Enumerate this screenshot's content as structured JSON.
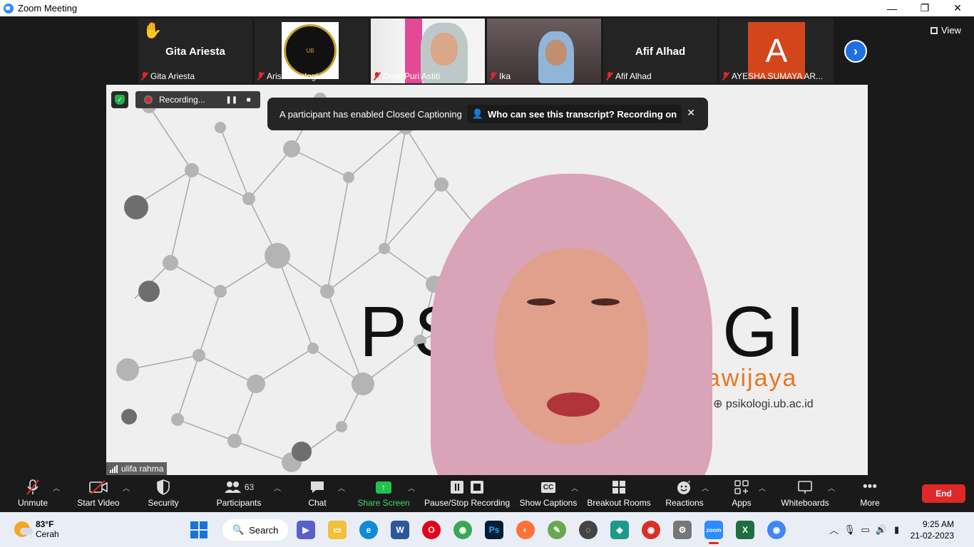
{
  "window": {
    "title": "Zoom Meeting",
    "minimize": "—",
    "maximize": "❐",
    "close": "✕"
  },
  "strip": {
    "thumbs": [
      {
        "center_name": "Gita Ariesta",
        "label": "Gita Ariesta"
      },
      {
        "label": "Aris Psikologi"
      },
      {
        "label": "Dewi Puri Astiti"
      },
      {
        "label": "Ika"
      },
      {
        "center_name": "Afif Alhad",
        "label": "Afif Alhad"
      },
      {
        "avatar_letter": "A",
        "label": "AYESHA SUMAYA AR..."
      }
    ],
    "next_icon": "›",
    "view_label": "View"
  },
  "main": {
    "recording_label": "Recording...",
    "cc_banner_text": "A participant has enabled Closed Captioning",
    "cc_banner_link": "Who can see this transcript? Recording on",
    "cc_close": "✕",
    "speaker_name": "ulifa rahma",
    "background_text": "PSIKOLOGI",
    "background_sub": "sBrawijaya",
    "background_web": "ologiub ⊕ psikologi.ub.ac.id"
  },
  "toolbar": {
    "unmute": "Unmute",
    "start_video": "Start Video",
    "security": "Security",
    "participants": "Participants",
    "participants_count": "63",
    "chat": "Chat",
    "share_screen": "Share Screen",
    "pause_stop_recording": "Pause/Stop Recording",
    "show_captions": "Show Captions",
    "breakout_rooms": "Breakout Rooms",
    "reactions": "Reactions",
    "apps": "Apps",
    "whiteboards": "Whiteboards",
    "more": "More",
    "end": "End",
    "cc_glyph": "CC"
  },
  "taskbar": {
    "temp": "83°F",
    "weather_desc": "Cerah",
    "search": "Search",
    "time": "9:25 AM",
    "date": "21-02-2023"
  },
  "colors": {
    "end_red": "#e02828",
    "share_green": "#22c24b",
    "accent_blue": "#2d8cff"
  }
}
